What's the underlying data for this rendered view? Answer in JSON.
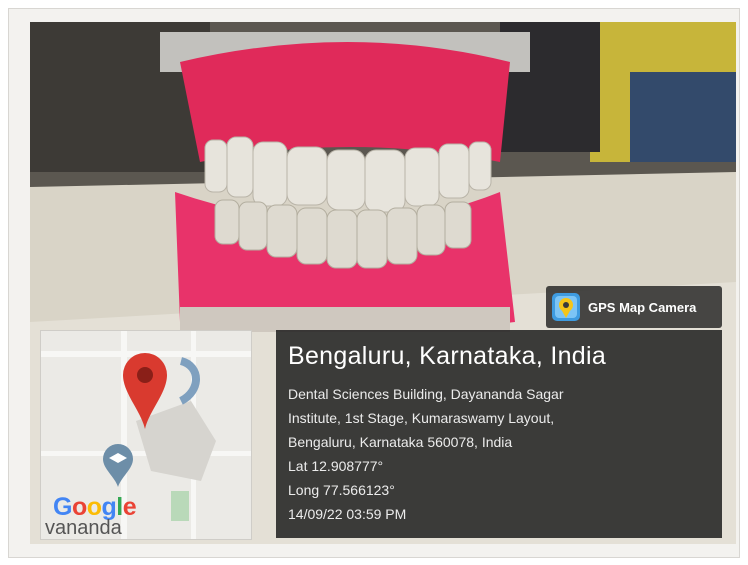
{
  "badge": {
    "label": "GPS Map Camera",
    "icon": "map-pin-camera-icon",
    "accent": "#3e9be0"
  },
  "location": {
    "title": "Bengaluru, Karnataka, India",
    "address_lines": [
      "Dental Sciences Building, Dayananda Sagar",
      "Institute, 1st Stage, Kumaraswamy Layout,",
      "Bengaluru, Karnataka 560078, India"
    ],
    "lat": "Lat 12.908777°",
    "long": "Long 77.566123°",
    "datetime": "14/09/22 03:59 PM"
  },
  "map": {
    "brand": [
      "G",
      "o",
      "o",
      "g",
      "l",
      "e"
    ],
    "brand_colors": [
      "#4285F4",
      "#EA4335",
      "#FBBC05",
      "#4285F4",
      "#34A853",
      "#EA4335"
    ],
    "place_label": "vananda",
    "pin_color": "#d93a2f"
  }
}
